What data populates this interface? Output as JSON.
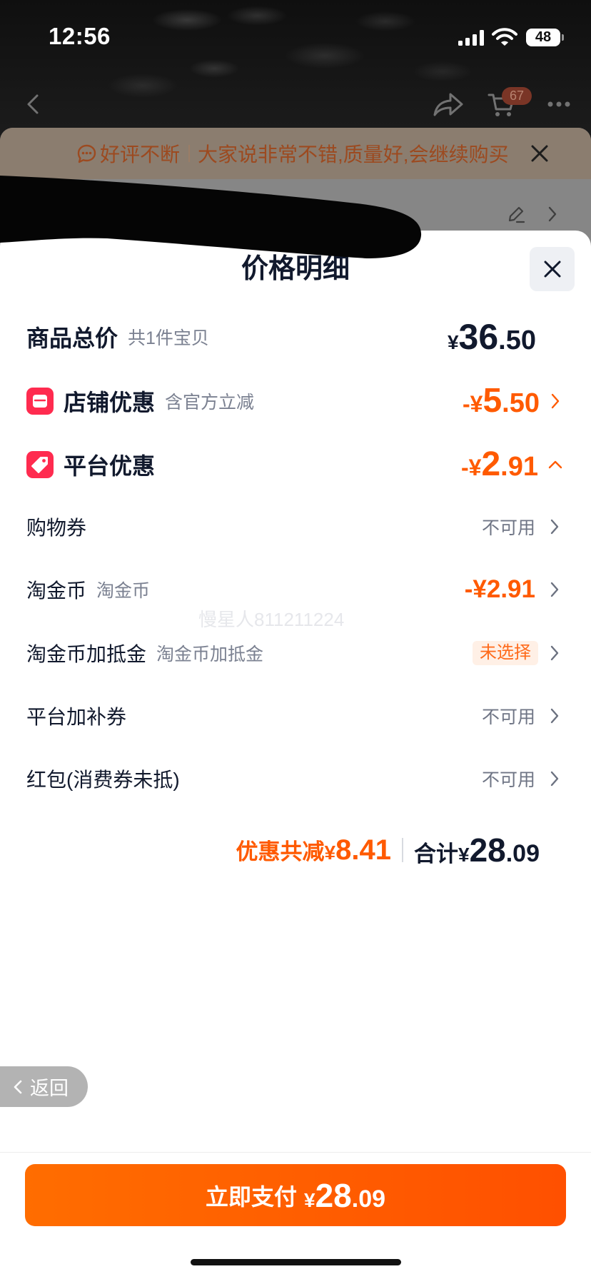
{
  "status_bar": {
    "time": "12:56",
    "battery_level": "48",
    "icons": [
      "cellular-signal-icon",
      "wifi-icon",
      "battery-icon"
    ]
  },
  "product_header": {
    "cart_badge": "67",
    "icons": [
      "back-icon",
      "share-icon",
      "cart-icon",
      "more-icon",
      "edit-icon",
      "chevron-right-icon"
    ]
  },
  "review_banner": {
    "icon": "chat-bubble-icon",
    "tag": "好评不断",
    "text": "大家说非常不错,质量好,会继续购买"
  },
  "price_sheet": {
    "title": "价格明细",
    "total": {
      "label": "商品总价",
      "note": "共1件宝贝",
      "currency": "¥",
      "amount_int": "36",
      "amount_dec": ".50"
    },
    "store_discount": {
      "icon": "shop-icon",
      "label": "店铺优惠",
      "note": "含官方立减",
      "prefix": "-¥",
      "amount_int": "5",
      "amount_dec": ".50"
    },
    "platform_discount": {
      "icon": "tag-icon",
      "label": "平台优惠",
      "prefix": "-¥",
      "amount_int": "2",
      "amount_dec": ".91",
      "expanded": true
    },
    "platform_items": [
      {
        "label": "购物券",
        "value": "不可用"
      },
      {
        "label": "淘金币",
        "note": "淘金币",
        "value": "-¥2.91"
      },
      {
        "label": "淘金币加抵金",
        "note": "淘金币加抵金",
        "value": "未选择"
      },
      {
        "label": "平台加补券",
        "value": "不可用"
      },
      {
        "label": "红包(消费券未抵)",
        "value": "不可用"
      }
    ],
    "summary": {
      "discount_label": "优惠共减",
      "discount_currency": "¥",
      "discount_amount": "8.41",
      "total_label": "合计",
      "total_currency": "¥",
      "total_int": "28",
      "total_dec": ".09"
    },
    "watermark": "慢星人811211224"
  },
  "back_pill": {
    "label": "返回"
  },
  "pay_button": {
    "label": "立即支付",
    "currency": "¥",
    "amount_int": "28",
    "amount_dec": ".09"
  },
  "colors": {
    "accent": "#ff5a00",
    "text": "#11192d",
    "muted": "#7b8191",
    "icon_red": "#ff2b4f",
    "badge_bg": "#fff0e6"
  }
}
